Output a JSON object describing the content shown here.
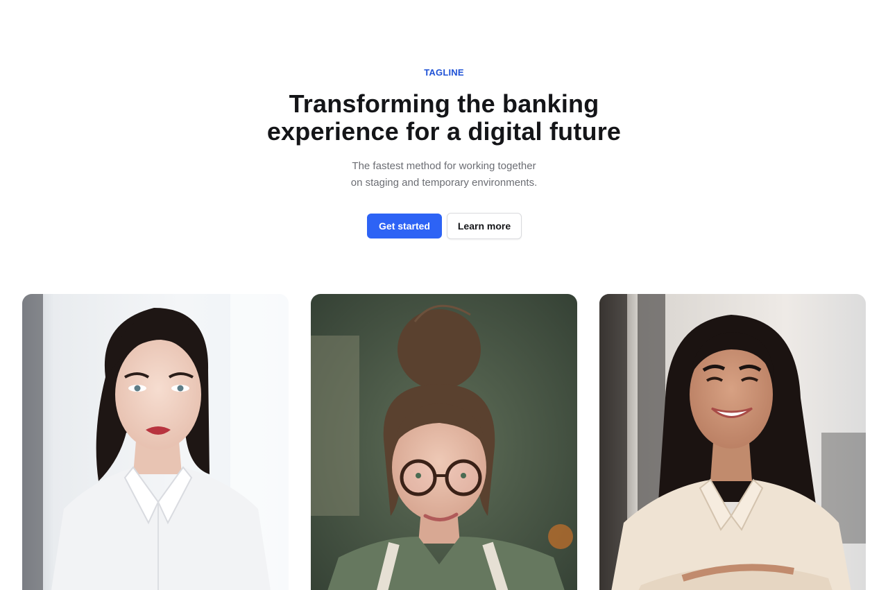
{
  "hero": {
    "tagline": "TAGLINE",
    "headline_line1": "Transforming the banking",
    "headline_line2": "experience for a digital future",
    "subtitle_line1": "The fastest method for working together",
    "subtitle_line2": "on staging and temporary environments.",
    "primary_button": "Get started",
    "secondary_button": "Learn more"
  },
  "colors": {
    "accent": "#2d63f5",
    "tagline": "#1f52d6",
    "heading": "#141518",
    "body_text": "#6b6d73"
  }
}
